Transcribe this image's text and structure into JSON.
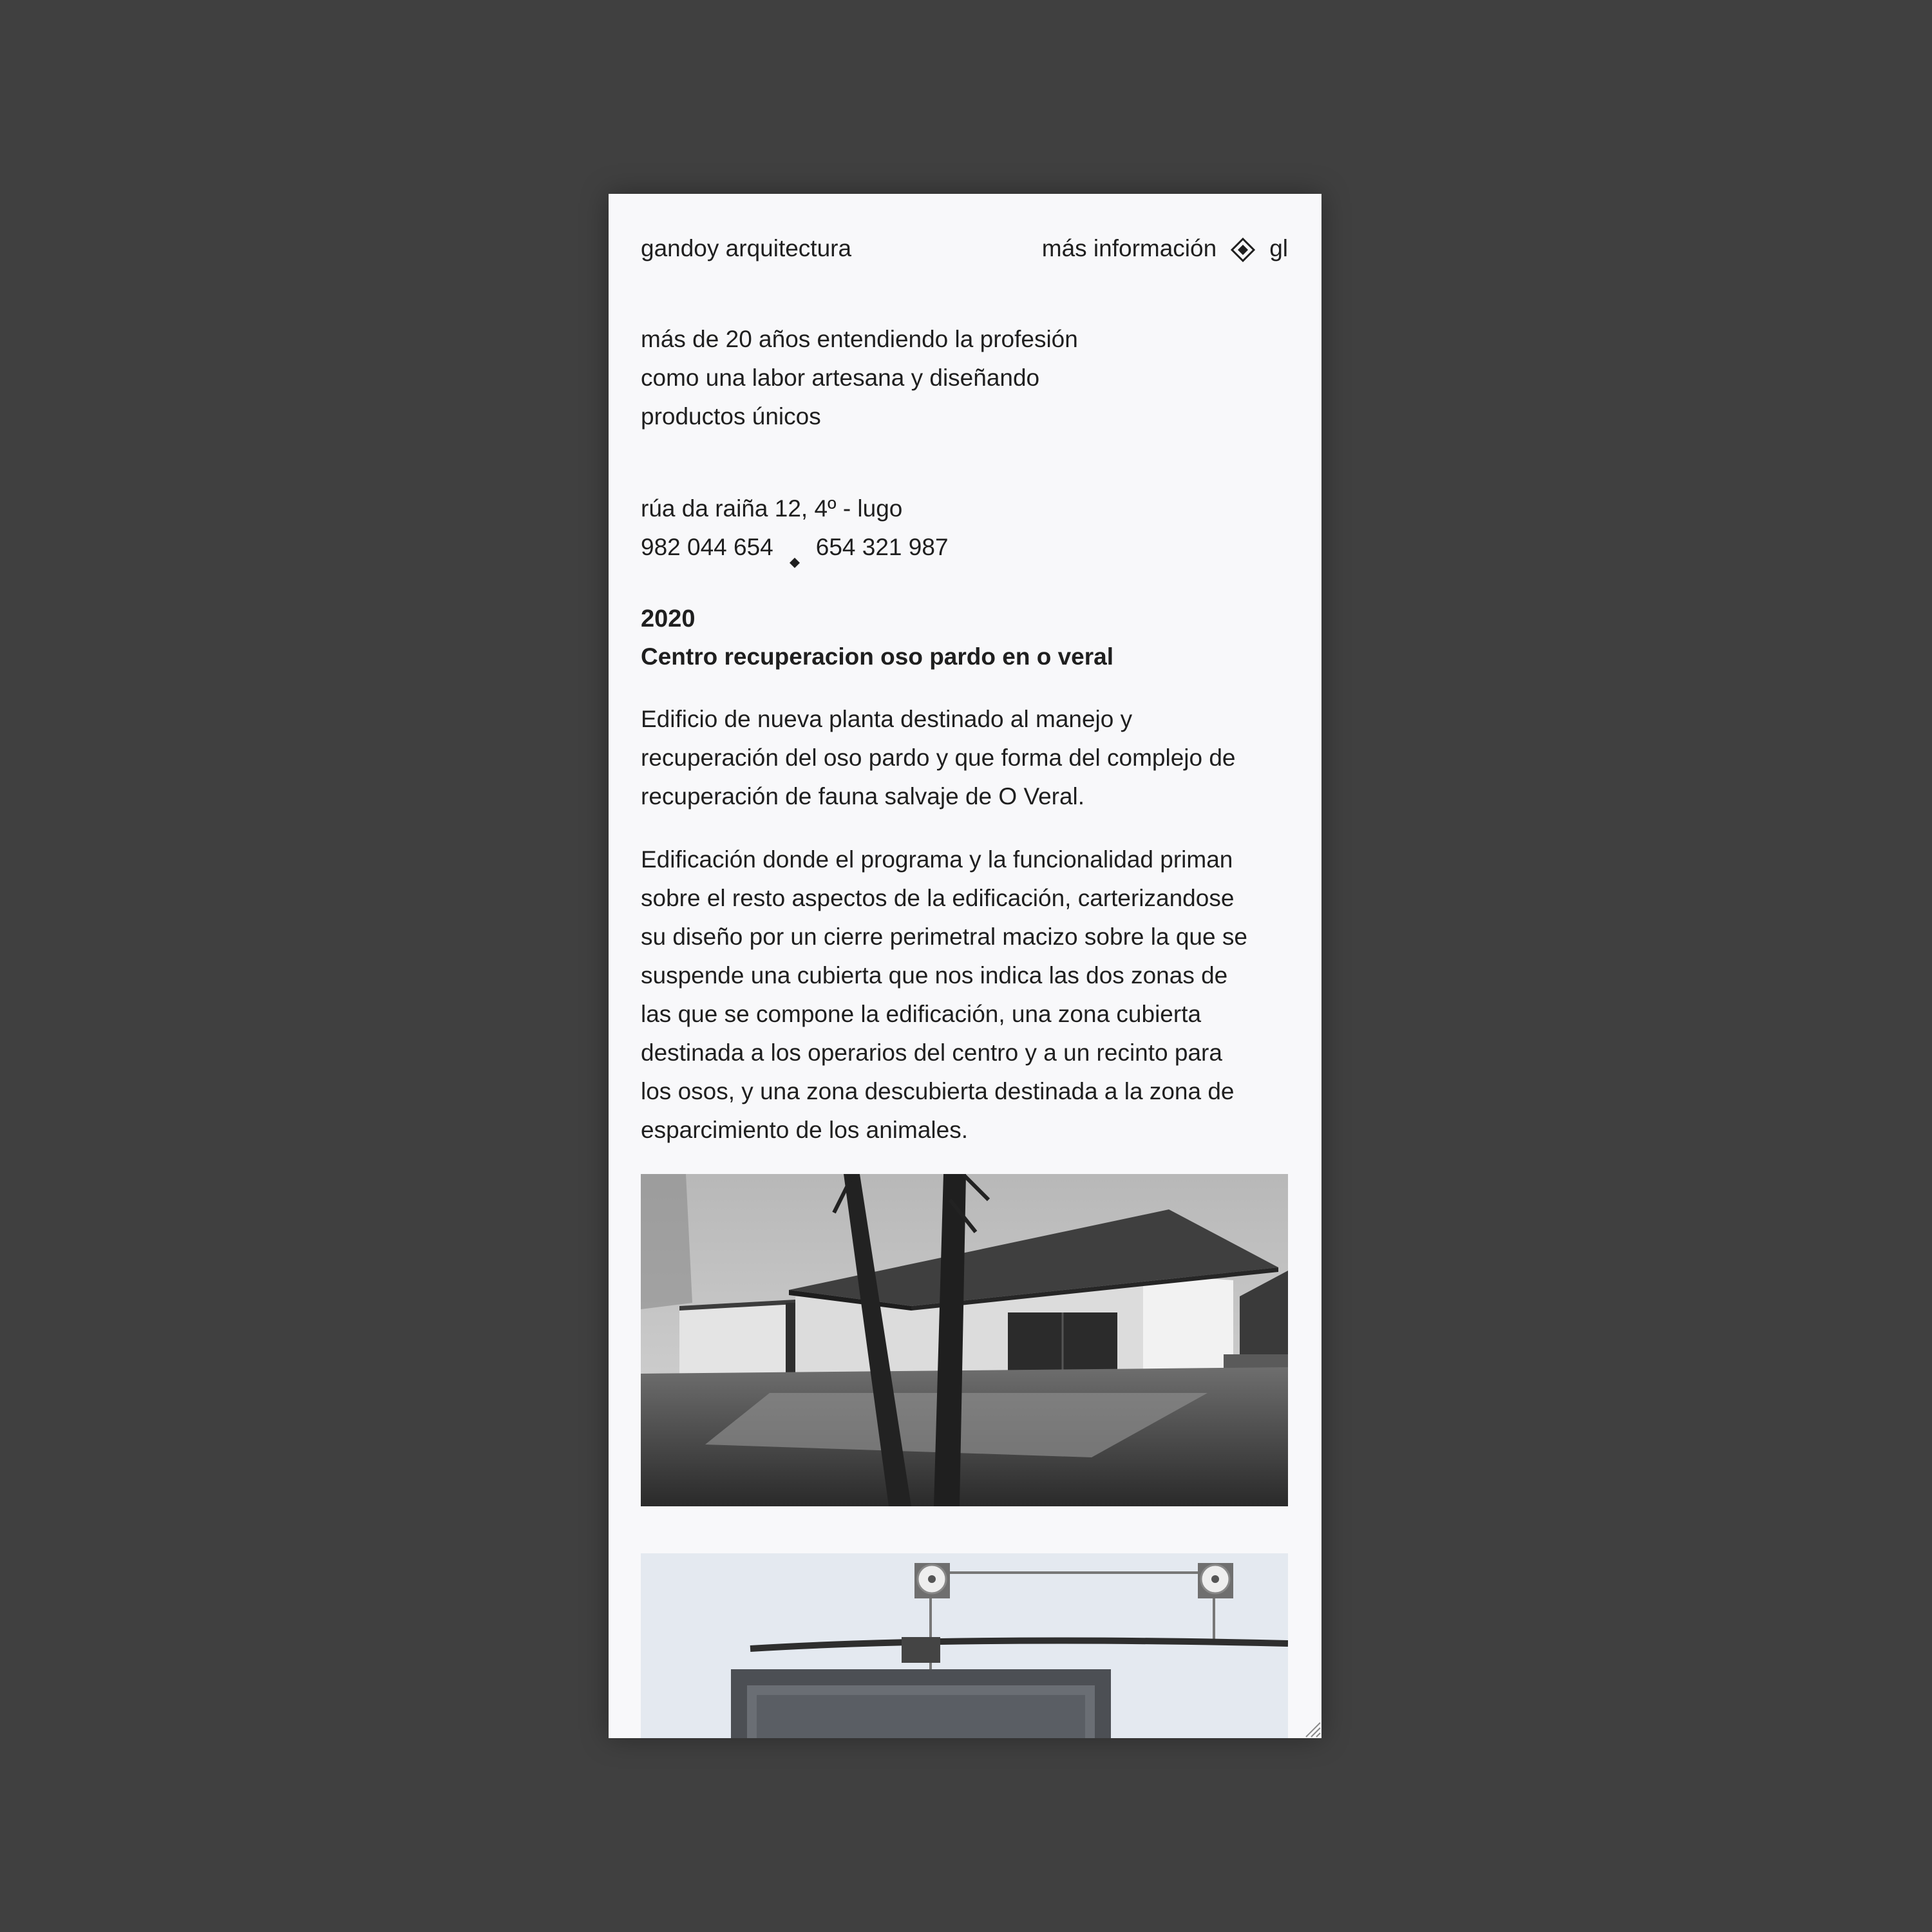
{
  "header": {
    "brand": "gandoy arquitectura",
    "more_info": "más información",
    "language": "gl"
  },
  "intro": {
    "lines": [
      "más de 20 años entendiendo la profesión",
      "como una labor artesana y diseñando",
      "productos únicos"
    ]
  },
  "contact": {
    "address": "rúa da raiña 12, 4º - lugo",
    "phone_1": "982 044 654",
    "phone_2": "654 321 987"
  },
  "project": {
    "year": "2020",
    "title": "Centro recuperacion oso pardo en o veral",
    "paragraph_1": [
      "Edificio de nueva planta destinado al manejo y",
      "recuperación del oso pardo y que forma del complejo de",
      "recuperación de fauna salvaje de O Veral."
    ],
    "paragraph_2": [
      "Edificación donde el programa y la funcionalidad priman",
      "sobre el resto aspectos de la edificación, carterizandose",
      "su diseño por un cierre perimetral macizo sobre la que se",
      "suspende una cubierta que nos indica las dos zonas de",
      "las que se compone la edificación, una zona cubierta",
      "destinada a los operarios del centro y a un recinto para",
      "los osos, y una zona descubierta destinada a la zona de",
      "esparcimiento de los animales."
    ]
  },
  "icons": {
    "language_separator": "diamond-outline-icon",
    "phone_separator": "diamond-icon",
    "resize": "resize-grip-icon"
  },
  "colors": {
    "background": "#404040",
    "page": "#f8f8fa",
    "text": "#1f1f1f"
  }
}
